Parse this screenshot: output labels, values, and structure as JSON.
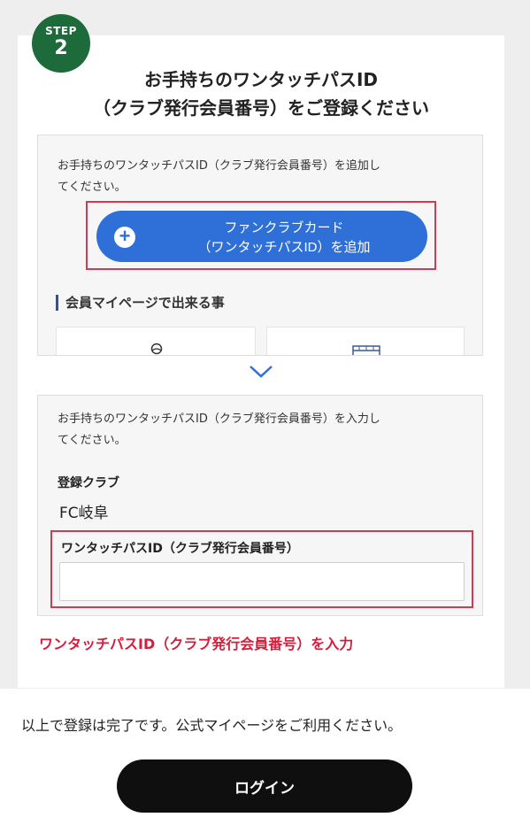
{
  "step": {
    "label": "STEP",
    "number": "2"
  },
  "title": {
    "line1": "お手持ちのワンタッチパスID",
    "line2": "（クラブ発行会員番号）をご登録ください"
  },
  "add_section": {
    "description_line1": "お手持ちのワンタッチパスID（クラブ発行会員番号）を追加し",
    "description_line2": "てください。",
    "add_button_line1": "ファンクラブカード",
    "add_button_line2": "（ワンタッチパスID）を追加",
    "mypage_heading": "会員マイページで出来る事"
  },
  "input_section": {
    "description_line1": "お手持ちのワンタッチパスID（クラブ発行会員番号）を入力し",
    "description_line2": "てください。",
    "club_label": "登録クラブ",
    "club_value": "FC岐阜",
    "id_label": "ワンタッチパスID（クラブ発行会員番号）",
    "id_value": "",
    "id_placeholder": ""
  },
  "warning": "ワンタッチパスID（クラブ発行会員番号）を入力",
  "complete_message": "以上で登録は完了です。公式マイページをご利用ください。",
  "login_button": "ログイン",
  "colors": {
    "badge_green": "#1d6b3a",
    "accent_blue": "#2f6fd8",
    "highlight_red": "#d23a52",
    "warning_red": "#d21f3c",
    "login_black": "#0f0f0f"
  },
  "icons": {
    "add": "plus-circle-icon",
    "expand": "chevron-down-icon",
    "tile1": "person-icon",
    "tile2": "calendar-icon"
  }
}
